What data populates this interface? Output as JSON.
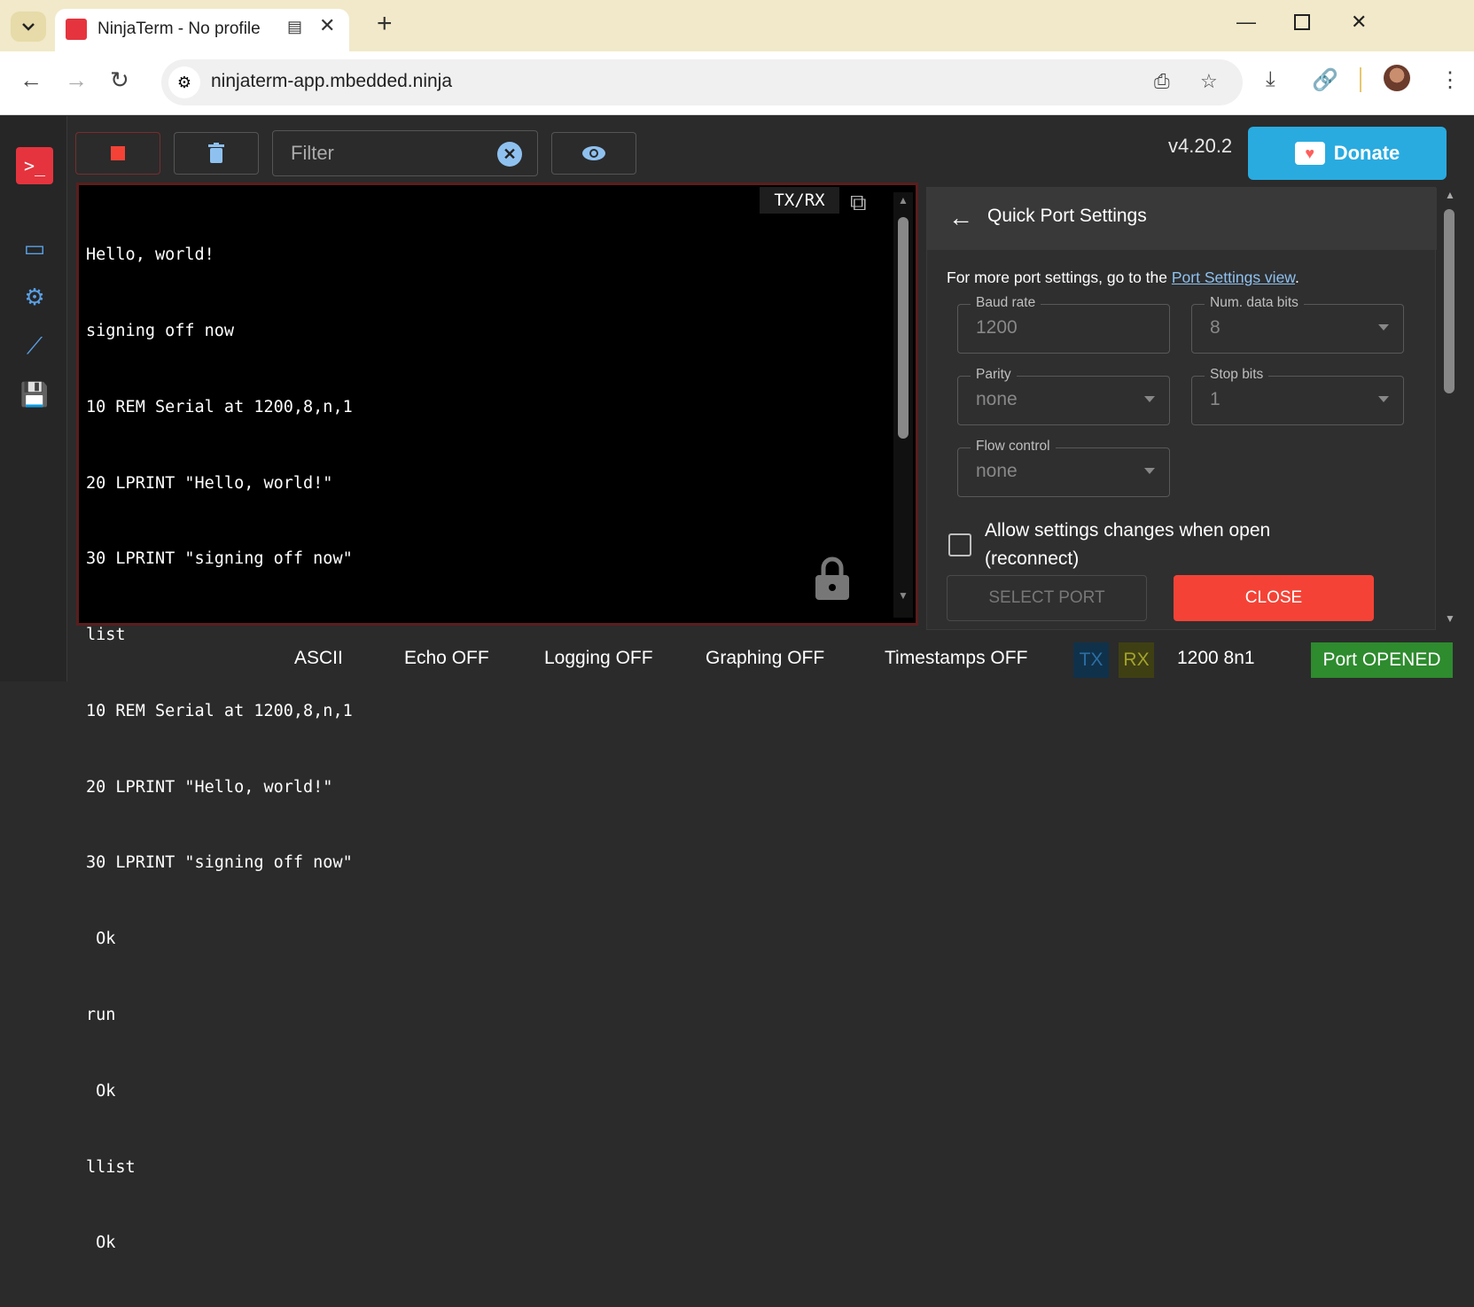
{
  "browser": {
    "tab_title": "NinjaTerm - No profile",
    "url": "ninjaterm-app.mbedded.ninja"
  },
  "toolbar": {
    "filter_placeholder": "Filter",
    "version": "v4.20.2",
    "donate_label": "Donate"
  },
  "terminal": {
    "label": "TX/RX",
    "lines": [
      "Hello, world!",
      "signing off now",
      "10 REM Serial at 1200,8,n,1",
      "20 LPRINT \"Hello, world!\"",
      "30 LPRINT \"signing off now\"",
      "list",
      "10 REM Serial at 1200,8,n,1",
      "20 LPRINT \"Hello, world!\"",
      "30 LPRINT \"signing off now\"",
      " Ok",
      "run",
      " Ok",
      "llist",
      " Ok"
    ]
  },
  "quick_port_settings": {
    "title": "Quick Port Settings",
    "intro": "For more port settings, go to the ",
    "link": "Port Settings view",
    "intro_end": ".",
    "baud_rate": {
      "label": "Baud rate",
      "value": "1200"
    },
    "data_bits": {
      "label": "Num. data bits",
      "value": "8"
    },
    "parity": {
      "label": "Parity",
      "value": "none"
    },
    "stop_bits": {
      "label": "Stop bits",
      "value": "1"
    },
    "flow_control": {
      "label": "Flow control",
      "value": "none"
    },
    "allow_changes": "Allow settings changes when open (reconnect)",
    "select_port": "SELECT PORT",
    "close": "CLOSE"
  },
  "status_bar": {
    "encoding": "ASCII",
    "echo": "Echo OFF",
    "logging": "Logging OFF",
    "graphing": "Graphing OFF",
    "timestamps": "Timestamps OFF",
    "tx": "TX",
    "rx": "RX",
    "config": "1200 8n1",
    "port_state": "Port OPENED"
  },
  "colors": {
    "accent_red": "#f44336",
    "link_blue": "#8ec1f0",
    "donate_blue": "#29abe0",
    "port_green": "#2e8b2e"
  }
}
